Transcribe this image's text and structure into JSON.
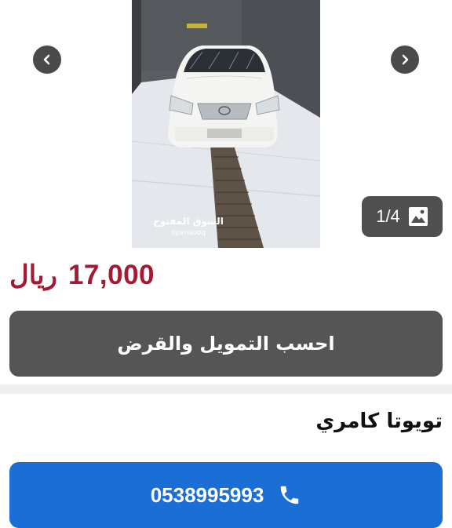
{
  "gallery": {
    "counter": "1/4",
    "watermark_ar": "السوق المفتوح",
    "watermark_en": "opensooq"
  },
  "listing": {
    "price_value": "17,000",
    "price_currency": "ريال",
    "finance_button_label": "احسب التمويل والقرض",
    "title": "تويوتا كامري",
    "phone": "0538995993"
  },
  "colors": {
    "price": "#a31a32",
    "call_button": "#1a6ed6",
    "finance_button": "#555555"
  }
}
